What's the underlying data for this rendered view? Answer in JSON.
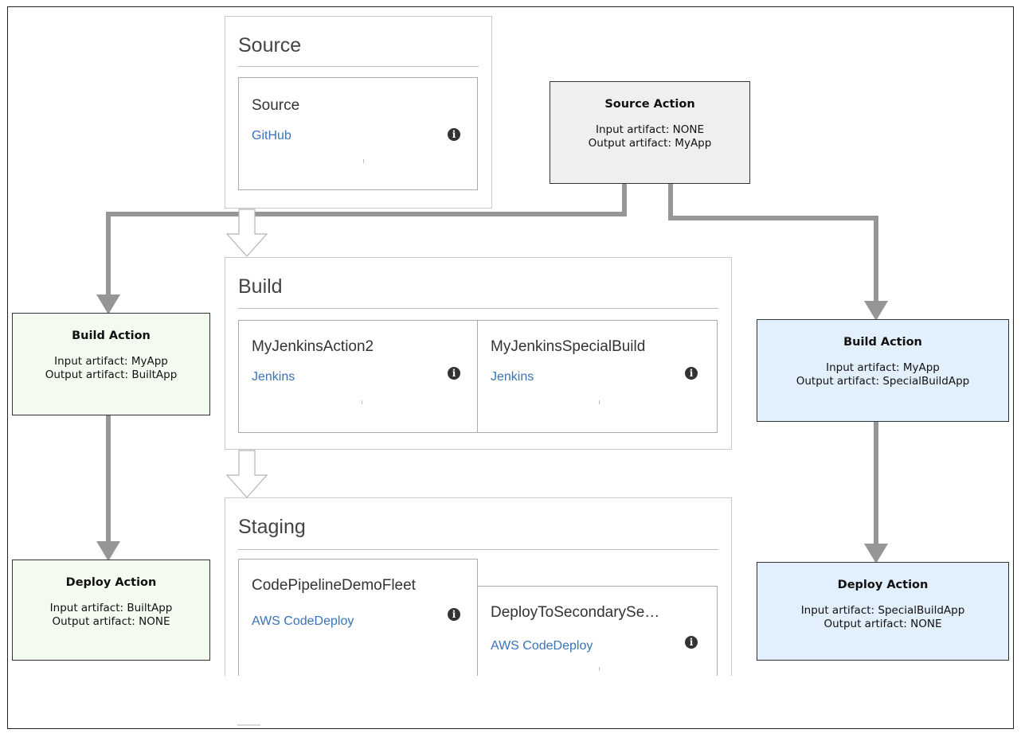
{
  "colors": {
    "arrow": "#969696",
    "link": "#3b73b9",
    "source_box": "#efefef",
    "left_box": "#f3fbf1",
    "right_box": "#e2effc"
  },
  "icons": {
    "info": "info-circle-icon",
    "transition": "down-arrow-outline-icon"
  },
  "stages": {
    "source": {
      "title": "Source",
      "actions": [
        {
          "name": "Source",
          "provider": "GitHub"
        }
      ]
    },
    "build": {
      "title": "Build",
      "actions": [
        {
          "name": "MyJenkinsAction2",
          "provider": "Jenkins"
        },
        {
          "name": "MyJenkinsSpecialBuild",
          "provider": "Jenkins"
        }
      ]
    },
    "staging": {
      "title": "Staging",
      "actions": [
        {
          "name": "CodePipelineDemoFleet",
          "provider": "AWS CodeDeploy"
        },
        {
          "name": "DeployToSecondarySe…",
          "provider": "AWS CodeDeploy"
        }
      ]
    }
  },
  "annotations": {
    "source_action": {
      "title": "Source Action",
      "input": "Input artifact: NONE",
      "output": "Output artifact: MyApp"
    },
    "build_left": {
      "title": "Build Action",
      "input": "Input artifact: MyApp",
      "output": "Output artifact: BuiltApp"
    },
    "deploy_left": {
      "title": "Deploy Action",
      "input": "Input artifact: BuiltApp",
      "output": "Output artifact: NONE"
    },
    "build_right": {
      "title": "Build Action",
      "input": "Input artifact: MyApp",
      "output": "Output artifact: SpecialBuildApp"
    },
    "deploy_right": {
      "title": "Deploy Action",
      "input": "Input artifact: SpecialBuildApp",
      "output": "Output artifact: NONE"
    }
  }
}
